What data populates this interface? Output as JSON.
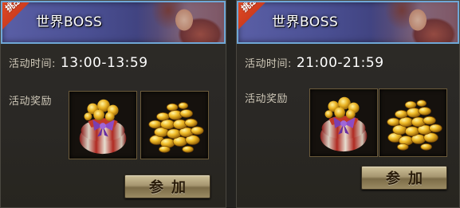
{
  "events": [
    {
      "badge": "挑战",
      "title": "世界BOSS",
      "time_label": "活动时间:",
      "time_value": "13:00-13:59",
      "reward_label": "活动奖励",
      "rewards": [
        "purple-ribbon-bag-icon",
        "gold-coins-icon"
      ],
      "join_label": "参加"
    },
    {
      "badge": "挑战",
      "title": "世界BOSS",
      "time_label": "活动时间:",
      "time_value": "21:00-21:59",
      "reward_label": "活动奖励",
      "rewards": [
        "purple-ribbon-bag-icon",
        "gold-coins-icon"
      ],
      "join_label": "参加"
    }
  ],
  "colors": {
    "header_border": "#6fa7d6",
    "badge": "#d63e20",
    "panel_bg": "#2b2925",
    "button_gold": "#a69670"
  }
}
